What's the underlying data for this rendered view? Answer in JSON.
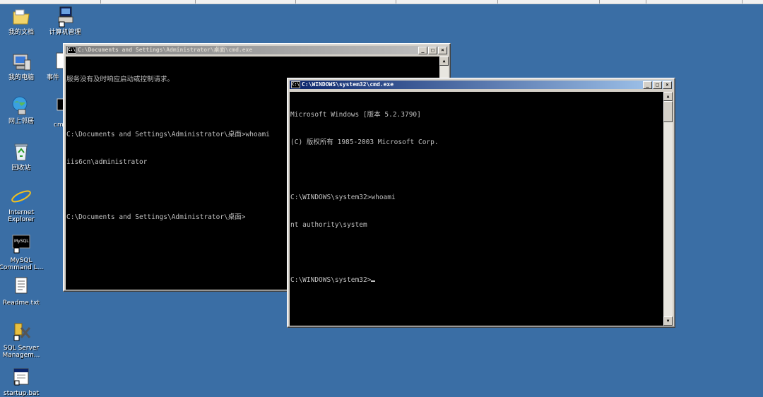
{
  "desktop": {
    "icons": [
      {
        "label": "我的文档",
        "icon": "folder-icon"
      },
      {
        "label": "计算机管理",
        "icon": "computer-management-icon"
      },
      {
        "label": "我的电脑",
        "icon": "my-computer-icon"
      },
      {
        "label": "事件",
        "icon": "event-viewer-icon"
      },
      {
        "label": "网上邻居",
        "icon": "network-places-icon"
      },
      {
        "label": "cmd",
        "icon": "cmd-shortcut-icon"
      },
      {
        "label": "回收站",
        "icon": "recycle-bin-icon"
      },
      {
        "label": "Internet\nExplorer",
        "icon": "ie-icon"
      },
      {
        "label": "MySQL\nCommand L...",
        "icon": "mysql-icon"
      },
      {
        "label": "Readme.txt",
        "icon": "text-file-icon"
      },
      {
        "label": "SQL Server\nManagem...",
        "icon": "sql-server-icon"
      },
      {
        "label": "startup.bat",
        "icon": "bat-file-icon"
      }
    ]
  },
  "window_back": {
    "title": "C:\\Documents and Settings\\Administrator\\桌面\\cmd.exe",
    "icon_text": "C:\\",
    "lines": [
      "服务没有及时响应启动或控制请求。",
      "",
      "C:\\Documents and Settings\\Administrator\\桌面>whoami",
      "iis6cn\\administrator",
      "",
      "C:\\Documents and Settings\\Administrator\\桌面>"
    ]
  },
  "window_front": {
    "title": "C:\\WINDOWS\\system32\\cmd.exe",
    "icon_text": "C:\\",
    "lines": [
      "Microsoft Windows [版本 5.2.3790]",
      "(C) 版权所有 1985-2003 Microsoft Corp.",
      "",
      "C:\\WINDOWS\\system32>whoami",
      "nt authority\\system",
      "",
      "C:\\WINDOWS\\system32>"
    ]
  },
  "buttons": {
    "minimize": "_",
    "maximize": "□",
    "close": "×"
  },
  "scroll": {
    "up": "▲",
    "down": "▼"
  }
}
